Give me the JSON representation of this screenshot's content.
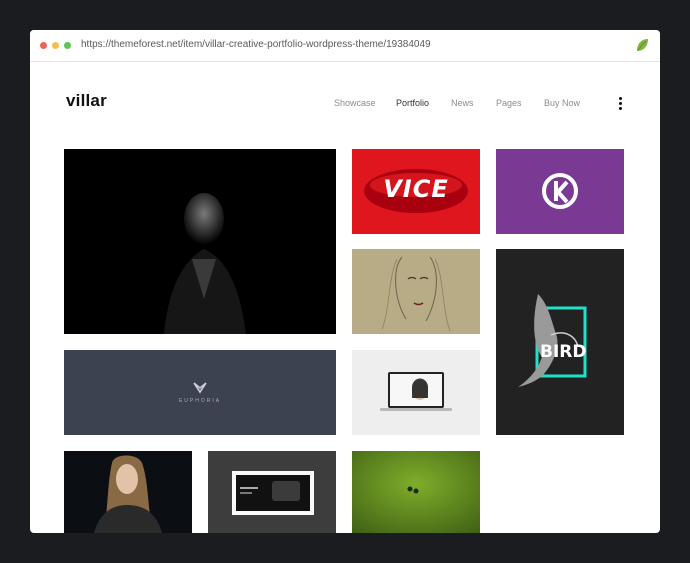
{
  "browser": {
    "url": "https://themeforest.net/item/villar-creative-portfolio-wordpress-theme/19384049"
  },
  "site": {
    "logo": "villar",
    "nav": [
      {
        "label": "Showcase",
        "active": false
      },
      {
        "label": "Portfolio",
        "active": true
      },
      {
        "label": "News",
        "active": false
      },
      {
        "label": "Pages",
        "active": false
      },
      {
        "label": "Buy Now",
        "active": false
      }
    ]
  },
  "portfolio": {
    "tiles": [
      {
        "name": "portrait-man"
      },
      {
        "name": "vice-lips",
        "text": "VICE"
      },
      {
        "name": "k-logo"
      },
      {
        "name": "sketch-woman"
      },
      {
        "name": "bird-poster",
        "text": "BIRD"
      },
      {
        "name": "euphoria-brand",
        "text": "EUPHORIA"
      },
      {
        "name": "laptop-mockup"
      },
      {
        "name": "woman-portrait"
      },
      {
        "name": "device-mockup"
      },
      {
        "name": "grass-field"
      }
    ]
  },
  "colors": {
    "background": "#1b1c1f",
    "vice_red": "#e0161e",
    "k_purple": "#7a3a93",
    "bird_accent": "#23e0c9",
    "euphoria_navy": "#3c4250"
  }
}
